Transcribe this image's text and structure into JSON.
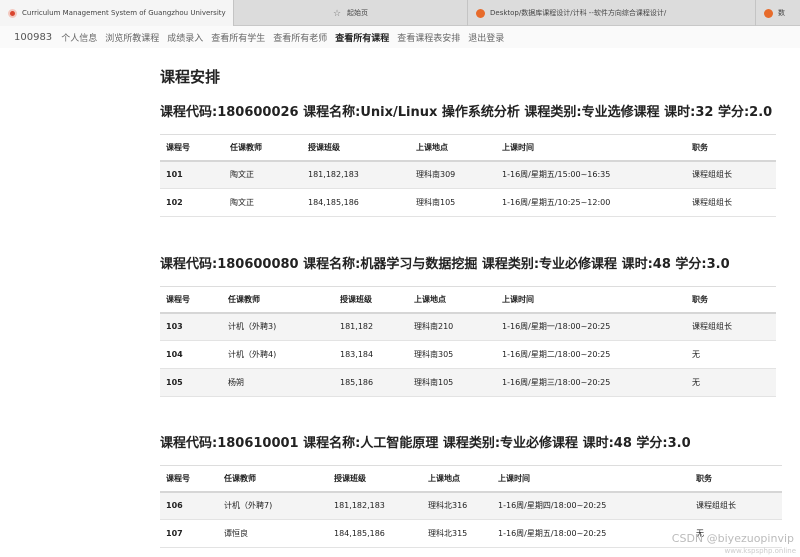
{
  "browser": {
    "tabs": [
      {
        "label": "Curriculum Management System of Guangzhou University",
        "icon": "university-logo-icon"
      },
      {
        "label": "起始页",
        "icon": "star-icon"
      },
      {
        "label": "Desktop/数据库课程设计/计科 --软件方向综合课程设计/",
        "icon": "folder-icon"
      },
      {
        "label": "数",
        "icon": "document-icon"
      }
    ]
  },
  "nav": {
    "user_id": "100983",
    "items": [
      "个人信息",
      "浏览所教课程",
      "成绩录入",
      "查看所有学生",
      "查看所有老师",
      "查看所有课程",
      "查看课程表安排",
      "退出登录"
    ],
    "active": "查看所有课程"
  },
  "page": {
    "title": "课程安排"
  },
  "courses": [
    {
      "header": "课程代码:180600026 课程名称:Unix/Linux 操作系统分析 课程类别:专业选修课程 课时:32 学分:2.0",
      "columns": [
        "课程号",
        "任课教师",
        "授课班级",
        "上课地点",
        "上课时间",
        "职务"
      ],
      "rows": [
        [
          "101",
          "陶文正",
          "181,182,183",
          "理科南309",
          "1-16周/星期五/15:00~16:35",
          "课程组组长"
        ],
        [
          "102",
          "陶文正",
          "184,185,186",
          "理科南105",
          "1-16周/星期五/10:25~12:00",
          "课程组组长"
        ]
      ]
    },
    {
      "header": "课程代码:180600080 课程名称:机器学习与数据挖掘 课程类别:专业必修课程 课时:48 学分:3.0",
      "columns": [
        "课程号",
        "任课教师",
        "授课班级",
        "上课地点",
        "上课时间",
        "职务"
      ],
      "rows": [
        [
          "103",
          "计机（外聘3)",
          "181,182",
          "理科南210",
          "1-16周/星期一/18:00~20:25",
          "课程组组长"
        ],
        [
          "104",
          "计机（外聘4)",
          "183,184",
          "理科南305",
          "1-16周/星期二/18:00~20:25",
          "无"
        ],
        [
          "105",
          "杨朔",
          "185,186",
          "理科南105",
          "1-16周/星期三/18:00~20:25",
          "无"
        ]
      ]
    },
    {
      "header": "课程代码:180610001 课程名称:人工智能原理 课程类别:专业必修课程 课时:48 学分:3.0",
      "columns": [
        "课程号",
        "任课教师",
        "授课班级",
        "上课地点",
        "上课时间",
        "职务"
      ],
      "rows": [
        [
          "106",
          "计机（外聘7)",
          "181,182,183",
          "理科北316",
          "1-16周/星期四/18:00~20:25",
          "课程组组长"
        ],
        [
          "107",
          "谭恒良",
          "184,185,186",
          "理科北315",
          "1-16周/星期五/18:00~20:25",
          "无"
        ]
      ]
    }
  ],
  "watermark": {
    "text": "CSDN @biyezuopinvip",
    "small": "www.kspsphp.online"
  }
}
